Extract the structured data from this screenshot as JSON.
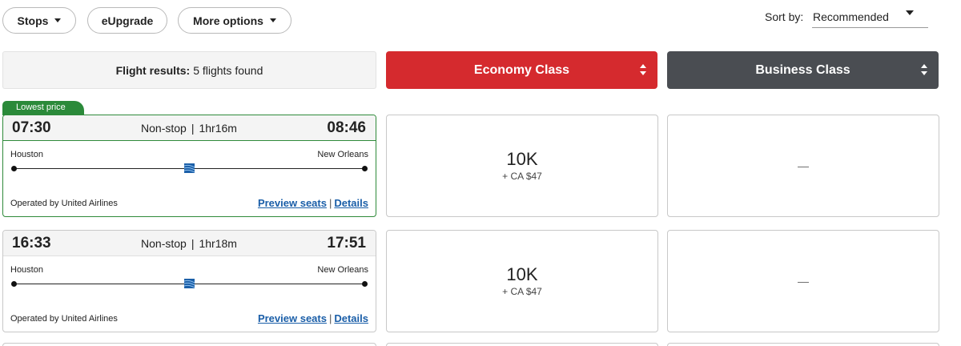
{
  "filters": {
    "stops": "Stops",
    "eupgrade": "eUpgrade",
    "more_options": "More options"
  },
  "sort": {
    "label": "Sort by:",
    "selected": "Recommended"
  },
  "results": {
    "label": "Flight results:",
    "count_text": "5 flights found"
  },
  "cabins": {
    "economy": "Economy Class",
    "business": "Business Class"
  },
  "colors": {
    "economy_tab": "#d52a2e",
    "business_tab": "#4a4d52",
    "lowest_price_badge": "#2b8a3a",
    "link": "#1a5ea8"
  },
  "flights": [
    {
      "badge": "Lowest price",
      "depart": "07:30",
      "arrive": "08:46",
      "stops": "Non-stop",
      "duration": "1hr16m",
      "origin": "Houston",
      "destination": "New Orleans",
      "operated_by": "Operated by United Airlines",
      "preview_seats": "Preview seats",
      "details": "Details",
      "economy": {
        "miles": "10K",
        "tax": "+ CA $47"
      },
      "business": {
        "text": "—"
      }
    },
    {
      "depart": "16:33",
      "arrive": "17:51",
      "stops": "Non-stop",
      "duration": "1hr18m",
      "origin": "Houston",
      "destination": "New Orleans",
      "operated_by": "Operated by United Airlines",
      "preview_seats": "Preview seats",
      "details": "Details",
      "economy": {
        "miles": "10K",
        "tax": "+ CA $47"
      },
      "business": {
        "text": "—"
      }
    }
  ],
  "icons": {
    "airline": "united-airlines-globe-icon",
    "sort_caret": "caret-down-icon",
    "cabin_sort": "sort-arrows-icon"
  }
}
